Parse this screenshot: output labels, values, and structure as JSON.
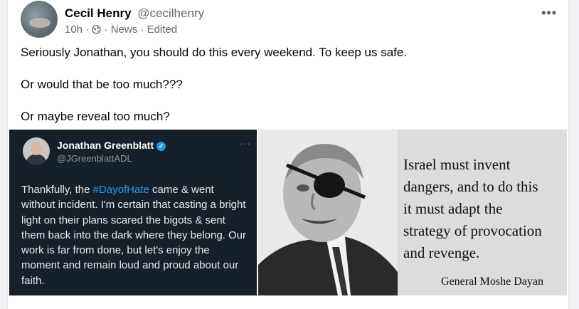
{
  "post": {
    "author_name": "Cecil Henry",
    "author_handle": "@cecilhenry",
    "time": "10h",
    "separator": "·",
    "audience_icon": "globe-icon",
    "category": "News",
    "edited": "Edited",
    "more_icon": "more-horizontal-icon",
    "text_lines": [
      "Seriously Jonathan, you should do this every weekend. To keep us safe.",
      "Or would that be too much???",
      "Or maybe reveal too much?"
    ]
  },
  "tweet": {
    "name": "Jonathan Greenblatt",
    "handle": "@JGreenblattADL",
    "verified_icon": "verified-badge-icon",
    "more_icon": "more-horizontal-icon",
    "text_before": "Thankfully, the ",
    "hashtag": "#DayofHate",
    "text_after": " came & went without incident. I'm certain that casting a bright light on their plans scared the bigots & sent them back into the dark where they belong. Our work is far from done, but let's enjoy the moment and remain loud and proud about our faith.",
    "accent_color": "#1d9bf0",
    "background_color": "#16202b"
  },
  "quote_image": {
    "quote_lines": [
      "Israel must invent",
      "dangers, and to do this",
      "it must adapt the",
      "strategy of provocation",
      "and revenge."
    ],
    "attribution": "General Moshe Dayan"
  }
}
